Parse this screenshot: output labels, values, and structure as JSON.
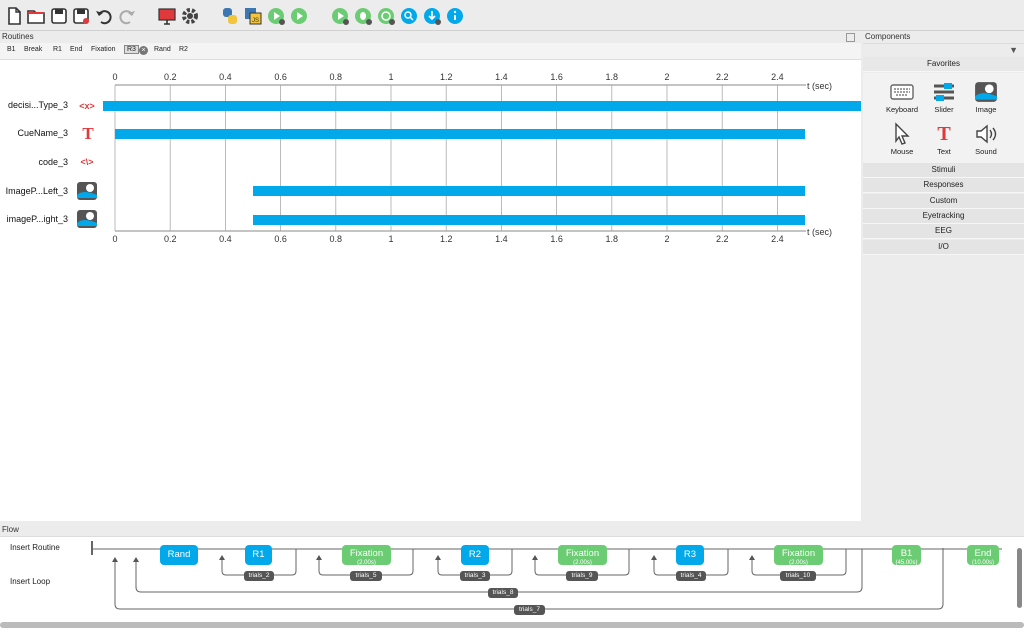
{
  "panels": {
    "routines": "Routines",
    "components": "Components",
    "flow": "Flow"
  },
  "routine_tabs": [
    "B1",
    "Break",
    "R1",
    "End",
    "Fixation",
    "R3",
    "Rand",
    "R2"
  ],
  "active_tab": "R3",
  "timeline": {
    "ticks": [
      "0",
      "0.2",
      "0.4",
      "0.6",
      "0.8",
      "1",
      "1.2",
      "1.4",
      "1.6",
      "1.8",
      "2",
      "2.2",
      "2.4"
    ],
    "unit_label": "t (sec)",
    "components": [
      {
        "name": "decisi...Type_3",
        "icon": "code-icon",
        "start": 0,
        "end": null
      },
      {
        "name": "CueName_3",
        "icon": "text-icon",
        "start": 0,
        "end": 2.5
      },
      {
        "name": "code_3",
        "icon": "code-icon",
        "start": null,
        "end": null
      },
      {
        "name": "ImageP...Left_3",
        "icon": "image-icon",
        "start": 0.5,
        "end": 2.5
      },
      {
        "name": "imageP...ight_3",
        "icon": "image-icon",
        "start": 0.5,
        "end": 2.5
      }
    ]
  },
  "components_panel": {
    "favorites_label": "Favorites",
    "favorites": [
      {
        "label": "Keyboard",
        "icon": "keyboard-icon"
      },
      {
        "label": "Slider",
        "icon": "slider-icon"
      },
      {
        "label": "Image",
        "icon": "image-icon"
      },
      {
        "label": "Mouse",
        "icon": "mouse-icon"
      },
      {
        "label": "Text",
        "icon": "text-icon"
      },
      {
        "label": "Sound",
        "icon": "sound-icon"
      }
    ],
    "categories": [
      "Stimuli",
      "Responses",
      "Custom",
      "Eyetracking",
      "EEG",
      "I/O"
    ]
  },
  "flow": {
    "insert_routine": "Insert Routine",
    "insert_loop": "Insert Loop",
    "routines": [
      {
        "label": "Rand",
        "color": "blue",
        "duration": ""
      },
      {
        "label": "R1",
        "color": "blue",
        "duration": ""
      },
      {
        "label": "Fixation",
        "color": "green",
        "duration": "(2.00s)"
      },
      {
        "label": "R2",
        "color": "blue",
        "duration": ""
      },
      {
        "label": "Fixation",
        "color": "green",
        "duration": "(2.00s)"
      },
      {
        "label": "R3",
        "color": "blue",
        "duration": ""
      },
      {
        "label": "Fixation",
        "color": "green",
        "duration": "(2.00s)"
      },
      {
        "label": "B1",
        "color": "green",
        "duration": "(45.00s)"
      },
      {
        "label": "End",
        "color": "green",
        "duration": "(10.00s)"
      }
    ],
    "loops": [
      "trials_2",
      "trials_5",
      "trials_3",
      "trials_9",
      "trials_4",
      "trials_10",
      "trials_8",
      "trials_7"
    ]
  },
  "colors": {
    "bar": "#02a9ea",
    "routine_blue": "#02a9ea",
    "routine_green": "#6ccc74",
    "loop_pill": "#555555",
    "text_red": "#e0393c"
  }
}
